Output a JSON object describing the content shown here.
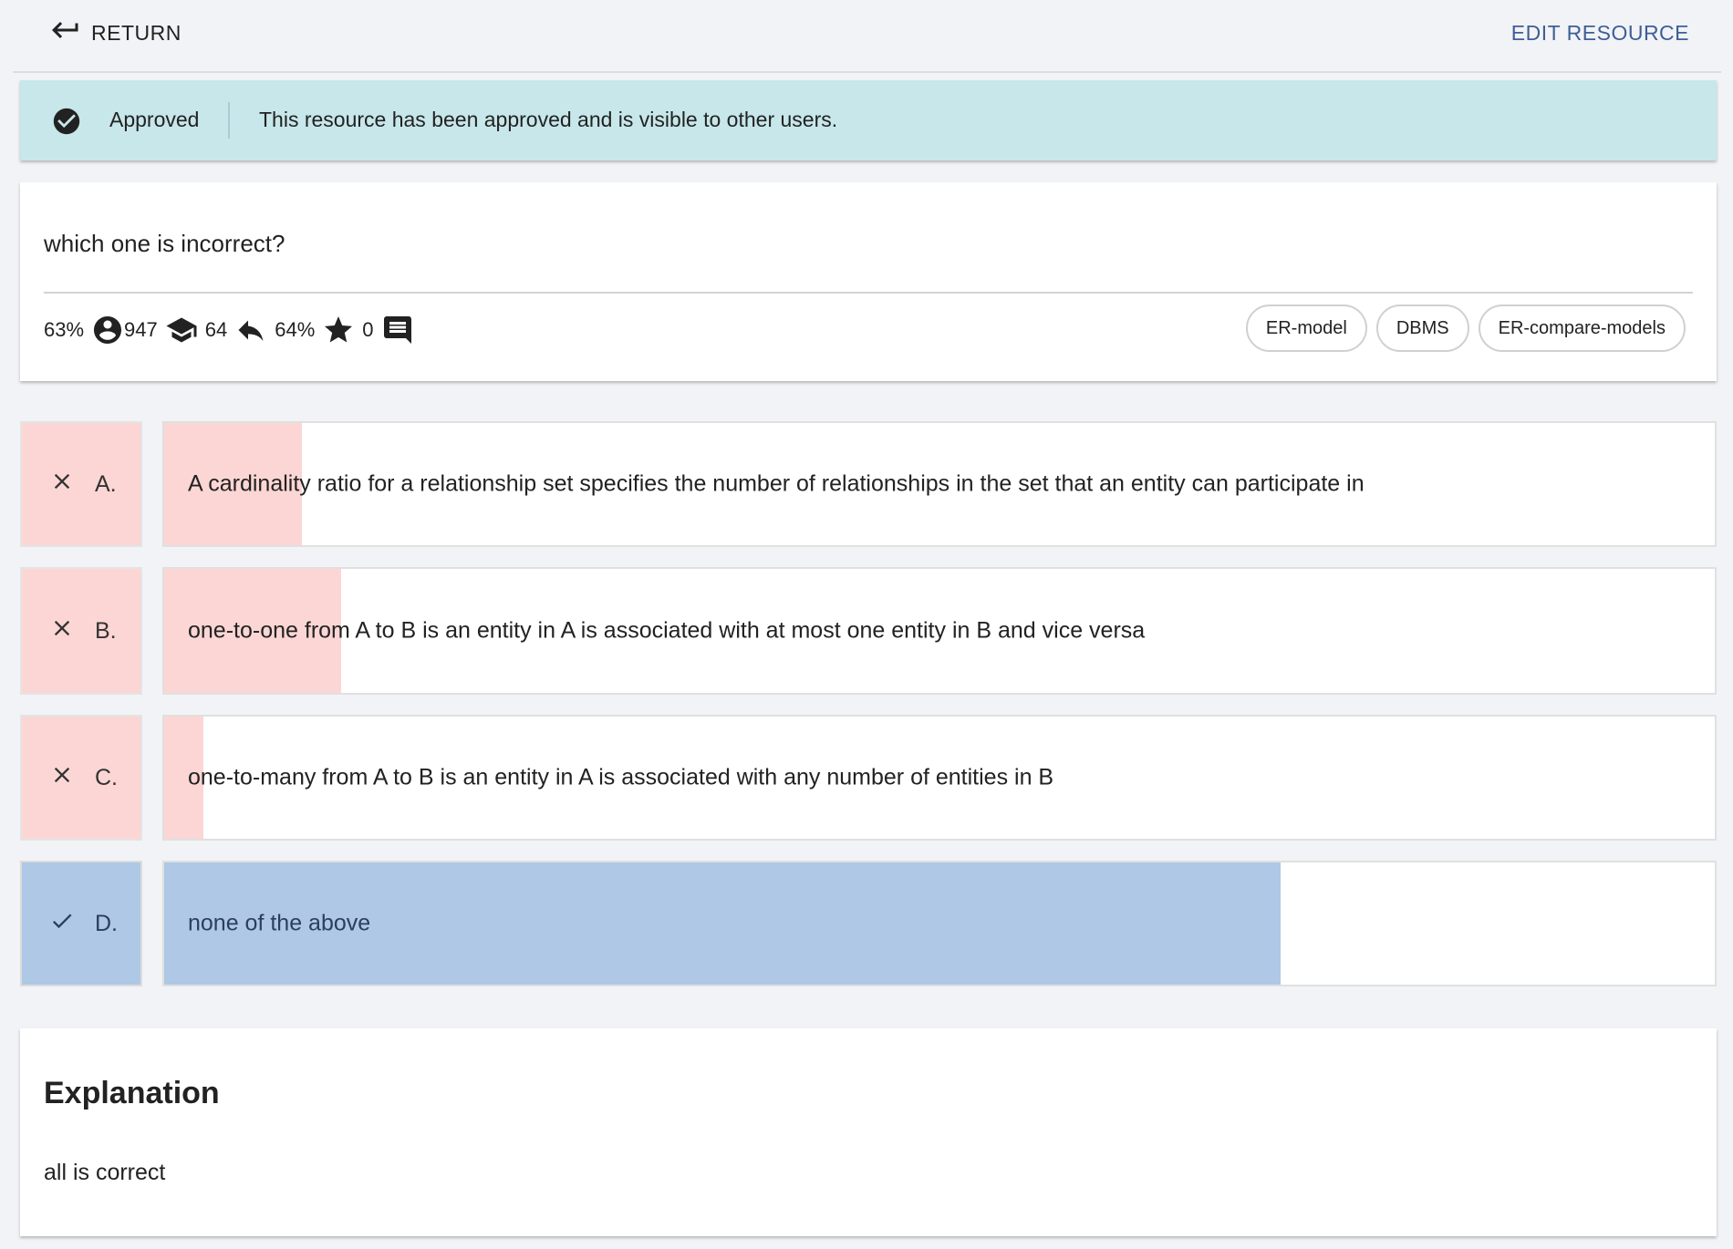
{
  "header": {
    "return_label": "RETURN",
    "edit_label": "EDIT RESOURCE"
  },
  "banner": {
    "status": "Approved",
    "message": "This resource has been approved and is visible to other users.",
    "color": "#c7e7ea"
  },
  "question": {
    "text": "which one is incorrect?",
    "stats": {
      "percent_correct": "63%",
      "users": "947",
      "level": "64",
      "percent_responses": "64%",
      "comments": "0"
    },
    "tags": [
      "ER-model",
      "DBMS",
      "ER-compare-models"
    ]
  },
  "answers": [
    {
      "letter": "A.",
      "text": "A cardinality ratio for a relationship set specifies the number of relationships in the set that an entity can participate in",
      "status": "incorrect",
      "fill_fraction": 0.089
    },
    {
      "letter": "B.",
      "text": "one-to-one from A to B is an entity in A is associated with at most one entity in B and vice versa",
      "status": "incorrect",
      "fill_fraction": 0.114
    },
    {
      "letter": "C.",
      "text": "one-to-many from A to B is an entity in A is associated with any number of entities in B",
      "status": "incorrect",
      "fill_fraction": 0.025
    },
    {
      "letter": "D.",
      "text": "none of  the above",
      "status": "correct",
      "fill_fraction": 0.72
    }
  ],
  "colors": {
    "incorrect": "#fbd6d4",
    "correct": "#aec8e6",
    "accent": "#3e5f96"
  },
  "explanation": {
    "title": "Explanation",
    "text": "all is correct"
  }
}
